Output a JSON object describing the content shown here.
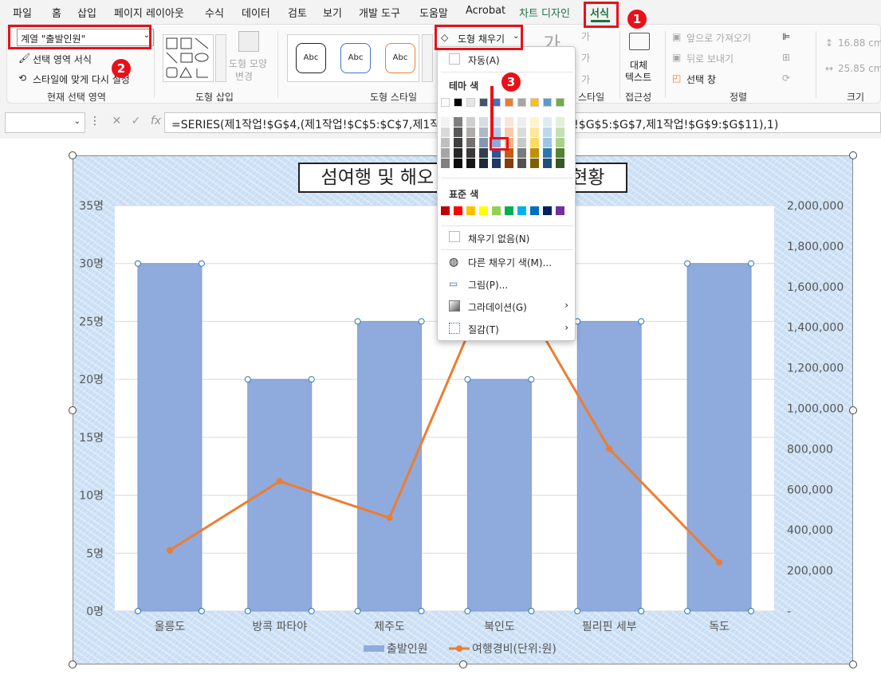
{
  "menu": {
    "tabs": [
      "파일",
      "홈",
      "삽입",
      "페이지 레이아웃",
      "수식",
      "데이터",
      "검토",
      "보기",
      "개발 도구",
      "도움말",
      "Acrobat",
      "차트 디자인",
      "서식"
    ],
    "active": "서식"
  },
  "ribbon": {
    "current_selection": {
      "dropdown_value": "계열 \"출발인원\"",
      "format_selection": "선택 영역 서식",
      "reset_style": "스타일에 맞게 다시 설정",
      "label": "현재 선택 영역"
    },
    "insert_shapes": {
      "change_shape": "도형 모양",
      "change_shape2": "변경",
      "label": "도형 삽입"
    },
    "shape_styles": {
      "thumb": "Abc",
      "fill_button": "도형 채우기",
      "label": "도형 스타일",
      "label_partial": "스타일"
    },
    "wordart": {
      "glyph": "가"
    },
    "accessibility": {
      "alt_text_line1": "대체",
      "alt_text_line2": "텍스트",
      "label": "접근성"
    },
    "arrange": {
      "bring_forward": "앞으로 가져오기",
      "send_backward": "뒤로 보내기",
      "selection_pane": "선택 창",
      "label": "정렬"
    },
    "size": {
      "height": "16.88 cm",
      "width": "25.85 cm",
      "label": "크기"
    }
  },
  "annotations": {
    "badge1": "1",
    "badge2": "2",
    "badge3": "3"
  },
  "formula_bar": {
    "cancel": "✕",
    "enter": "✓",
    "fx": "fx",
    "formula": "=SERIES(제1작업!$G$4,(제1작업!$C$5:$C$7,제1작업!$C$9:$C$11),(제1작업!$G$5:$G$7,제1작업!$G$9:$G$11),1)"
  },
  "dropdown": {
    "auto": "자동(A)",
    "theme_colors_header": "테마 색",
    "standard_colors_header": "표준 색",
    "no_fill": "채우기 없음(N)",
    "more_colors": "다른 채우기 색(M)...",
    "picture": "그림(P)...",
    "gradient": "그라데이션(G)",
    "texture": "질감(T)",
    "theme_colors_top": [
      "#ffffff",
      "#000000",
      "#e7e6e6",
      "#44546a",
      "#4472c4",
      "#ed7d31",
      "#a5a5a5",
      "#ffc000",
      "#5b9bd5",
      "#70ad47"
    ],
    "theme_colors_shades": [
      [
        "#f2f2f2",
        "#7f7f7f",
        "#d0cece",
        "#d6dce4",
        "#d9e2f3",
        "#fbe5d6",
        "#ededed",
        "#fff2cc",
        "#deebf7",
        "#e2efda"
      ],
      [
        "#d9d9d9",
        "#595959",
        "#aeabab",
        "#adb9ca",
        "#b4c7e7",
        "#f8cbad",
        "#dbdbdb",
        "#ffe699",
        "#bdd7ee",
        "#c5e0b4"
      ],
      [
        "#bfbfbf",
        "#404040",
        "#757171",
        "#8497b0",
        "#8faadc",
        "#f4b183",
        "#c9c9c9",
        "#ffd966",
        "#9dc3e6",
        "#a9d18e"
      ],
      [
        "#a6a6a6",
        "#262626",
        "#3a3838",
        "#323f4f",
        "#2f5597",
        "#c55a11",
        "#7b7b7b",
        "#bf9000",
        "#2e75b6",
        "#538135"
      ],
      [
        "#808080",
        "#0d0d0d",
        "#171616",
        "#222a35",
        "#203864",
        "#843c0c",
        "#525252",
        "#7f6000",
        "#1f4e79",
        "#385723"
      ]
    ],
    "standard_colors": [
      "#c00000",
      "#ff0000",
      "#ffc000",
      "#ffff00",
      "#92d050",
      "#00b050",
      "#00b0f0",
      "#0070c0",
      "#002060",
      "#7030a0"
    ]
  },
  "chart_data": {
    "type": "bar",
    "title": "섬여행 및 해오",
    "title_right": "현황",
    "categories": [
      "울릉도",
      "방콕 파타야",
      "제주도",
      "북인도",
      "필리핀 세부",
      "독도"
    ],
    "series": [
      {
        "name": "출발인원",
        "type": "bar",
        "axis": "left",
        "color": "#8faadc",
        "values": [
          30,
          20,
          25,
          20,
          25,
          30
        ]
      },
      {
        "name": "여행경비(단위:원)",
        "type": "line",
        "axis": "right",
        "color": "#ed7d31",
        "values": [
          300000,
          640000,
          460000,
          1730000,
          800000,
          240000
        ]
      }
    ],
    "y_left": {
      "min": 0,
      "max": 35,
      "ticks": [
        "0명",
        "5명",
        "10명",
        "15명",
        "20명",
        "25명",
        "30명",
        "35명"
      ]
    },
    "y_right": {
      "min": 0,
      "max": 2000000,
      "ticks": [
        "-",
        "200,000",
        "400,000",
        "600,000",
        "800,000",
        "1,000,000",
        "1,200,000",
        "1,400,000",
        "1,600,000",
        "1,800,000",
        "2,000,000"
      ]
    },
    "legend": {
      "placement": "bottom",
      "entries": [
        "출발인원",
        "여행경비(단위:원)"
      ]
    },
    "grid": true
  }
}
